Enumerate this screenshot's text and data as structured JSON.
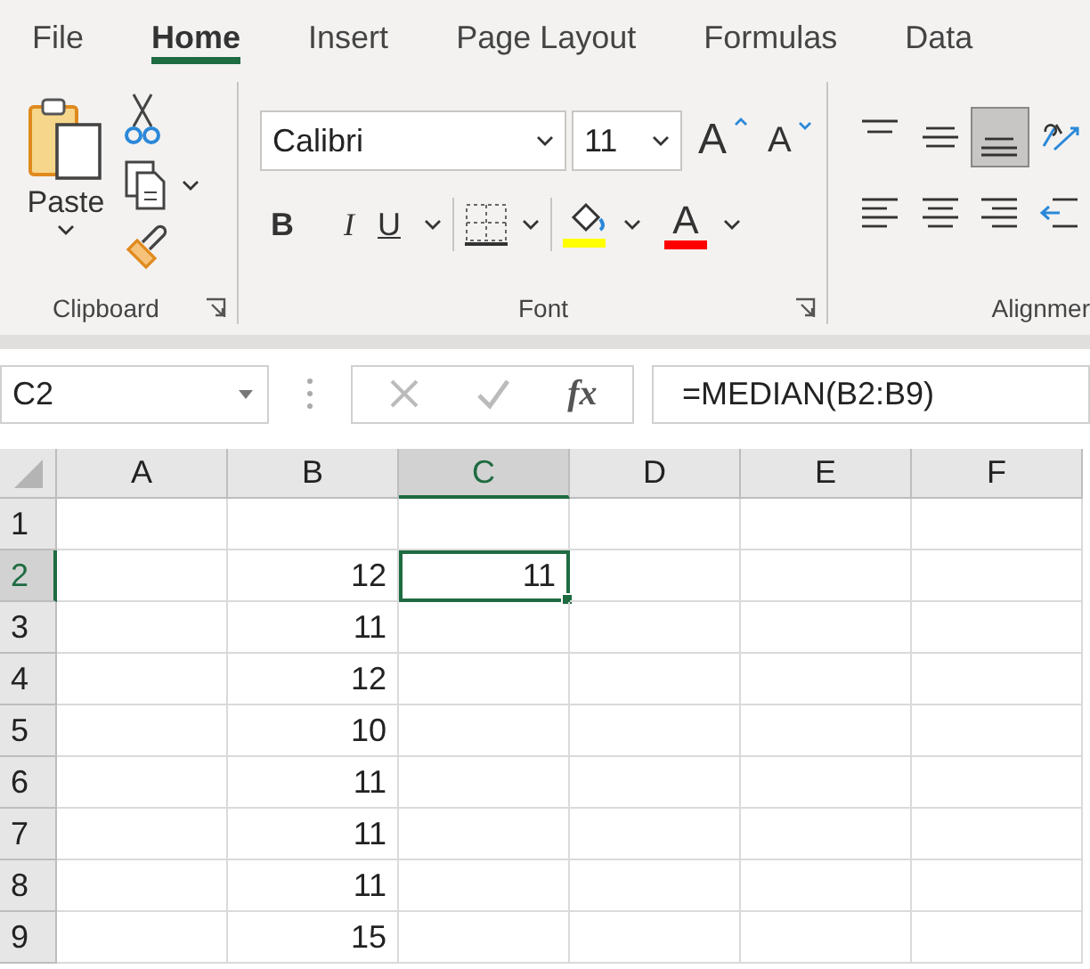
{
  "tabs": [
    {
      "label": "File",
      "selected": false
    },
    {
      "label": "Home",
      "selected": true
    },
    {
      "label": "Insert",
      "selected": false
    },
    {
      "label": "Page Layout",
      "selected": false
    },
    {
      "label": "Formulas",
      "selected": false
    },
    {
      "label": "Data",
      "selected": false
    }
  ],
  "clipboard": {
    "paste_label": "Paste",
    "group_label": "Clipboard"
  },
  "font": {
    "font_name": "Calibri",
    "font_size": "11",
    "grow_label": "A",
    "shrink_label": "A",
    "bold_label": "B",
    "italic_label": "I",
    "underline_label": "U",
    "font_color_label": "A",
    "group_label": "Font"
  },
  "alignment": {
    "group_label": "Alignmer",
    "top_row": [
      {
        "kind": "top",
        "selected": false
      },
      {
        "kind": "middle",
        "selected": false
      },
      {
        "kind": "bottom",
        "selected": true
      },
      {
        "kind": "orientation",
        "selected": false
      }
    ],
    "bottom_row": [
      {
        "kind": "left",
        "selected": false
      },
      {
        "kind": "center",
        "selected": false
      },
      {
        "kind": "right",
        "selected": false
      },
      {
        "kind": "indent",
        "selected": false
      }
    ]
  },
  "formula_bar": {
    "name_box": "C2",
    "fx_label": "fx",
    "formula": "=MEDIAN(B2:B9)"
  },
  "sheet": {
    "columns": [
      {
        "label": "A",
        "selected": false
      },
      {
        "label": "B",
        "selected": false
      },
      {
        "label": "C",
        "selected": true
      },
      {
        "label": "D",
        "selected": false
      },
      {
        "label": "E",
        "selected": false
      },
      {
        "label": "F",
        "selected": false
      }
    ],
    "rows": [
      {
        "header": "1",
        "selected": false
      },
      {
        "header": "2",
        "selected": true,
        "column_b": "12",
        "column_c": "11"
      },
      {
        "header": "3",
        "selected": false,
        "column_b": "11"
      },
      {
        "header": "4",
        "selected": false,
        "column_b": "12"
      },
      {
        "header": "5",
        "selected": false,
        "column_b": "10"
      },
      {
        "header": "6",
        "selected": false,
        "column_b": "11"
      },
      {
        "header": "7",
        "selected": false,
        "column_b": "11"
      },
      {
        "header": "8",
        "selected": false,
        "column_b": "11"
      },
      {
        "header": "9",
        "selected": false,
        "column_b": "15"
      }
    ]
  }
}
